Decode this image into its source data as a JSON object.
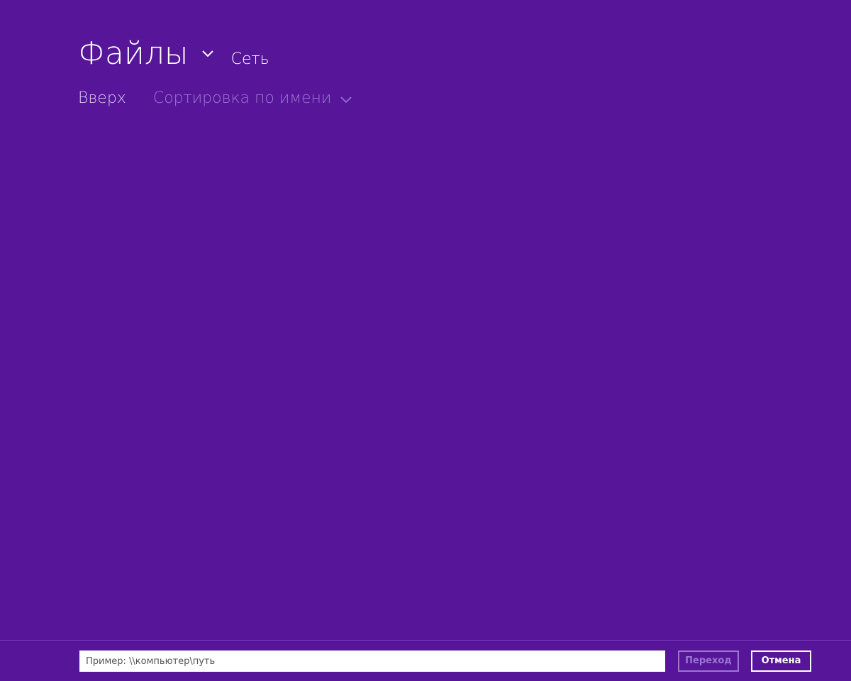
{
  "header": {
    "title": "Файлы",
    "title_icon": "chevron-down-icon",
    "location": "Сеть"
  },
  "subnav": {
    "up_label": "Вверх",
    "sort_label": "Сортировка по имени",
    "sort_icon": "chevron-down-icon"
  },
  "bottom_bar": {
    "path_input": {
      "value": "",
      "placeholder": "Пример: \\\\компьютер\\путь"
    },
    "go_label": "Переход",
    "cancel_label": "Отмена"
  },
  "colors": {
    "background": "#57169a",
    "text_primary": "#ffffff",
    "text_secondary": "#d9c8f0",
    "text_disabled": "#9a78cf",
    "divider": "#7a3fc0"
  }
}
